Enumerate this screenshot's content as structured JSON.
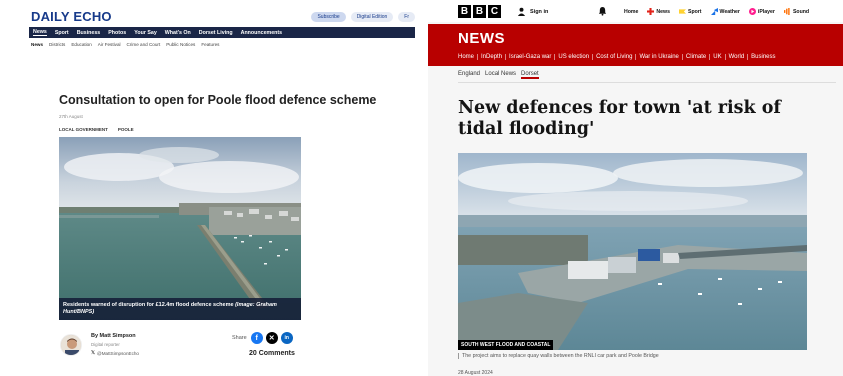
{
  "daily_echo": {
    "logo": "DAILY ECHO",
    "top_buttons": [
      "Subscribe",
      "Digital Edition",
      "Fr"
    ],
    "nav": [
      "News",
      "Sport",
      "Business",
      "Photos",
      "Your Say",
      "What's On",
      "Dorset Living",
      "Announcements"
    ],
    "subnav": [
      "News",
      "Districts",
      "Education",
      "Air Festival",
      "Crime and Court",
      "Public Notices",
      "Features"
    ],
    "headline": "Consultation to open for Poole flood defence scheme",
    "date": "27th August",
    "tags": [
      "LOCAL GOVERNMENT",
      "POOLE"
    ],
    "caption_main": "Residents warned of disruption for £12.4m flood defence scheme ",
    "caption_credit": "(Image: Graham Hunt/BNPS)",
    "author": {
      "name": "By Matt Simpson",
      "role": "Digital reporter",
      "handle": "@MattSimpsonEcho"
    },
    "share_label": "Share",
    "comments": "20 Comments",
    "colors": {
      "brand": "#173a8a",
      "nav_bg": "#1a2647"
    }
  },
  "bbc": {
    "blocks": [
      "B",
      "B",
      "C"
    ],
    "signin": "Sign in",
    "topnav": [
      {
        "label": "Home",
        "icon": ""
      },
      {
        "label": "News",
        "icon": "news-icon"
      },
      {
        "label": "Sport",
        "icon": "sport-icon"
      },
      {
        "label": "Weather",
        "icon": "weather-icon"
      },
      {
        "label": "iPlayer",
        "icon": "iplayer-icon"
      },
      {
        "label": "Sound",
        "icon": "sound-icon"
      }
    ],
    "section_logo": "NEWS",
    "newsnav": [
      "Home",
      "InDepth",
      "Israel-Gaza war",
      "US election",
      "Cost of Living",
      "War in Ukraine",
      "Climate",
      "UK",
      "World",
      "Business"
    ],
    "subnav": [
      "England",
      "Local News",
      "Dorset"
    ],
    "headline": "New defences for town 'at risk of tidal flooding'",
    "image_credit": "SOUTH WEST FLOOD AND COASTAL",
    "caption": "The project aims to replace quay walls between the RNLI car park and Poole Bridge",
    "date": "28 August 2024",
    "colors": {
      "brand_red": "#b80000"
    }
  }
}
